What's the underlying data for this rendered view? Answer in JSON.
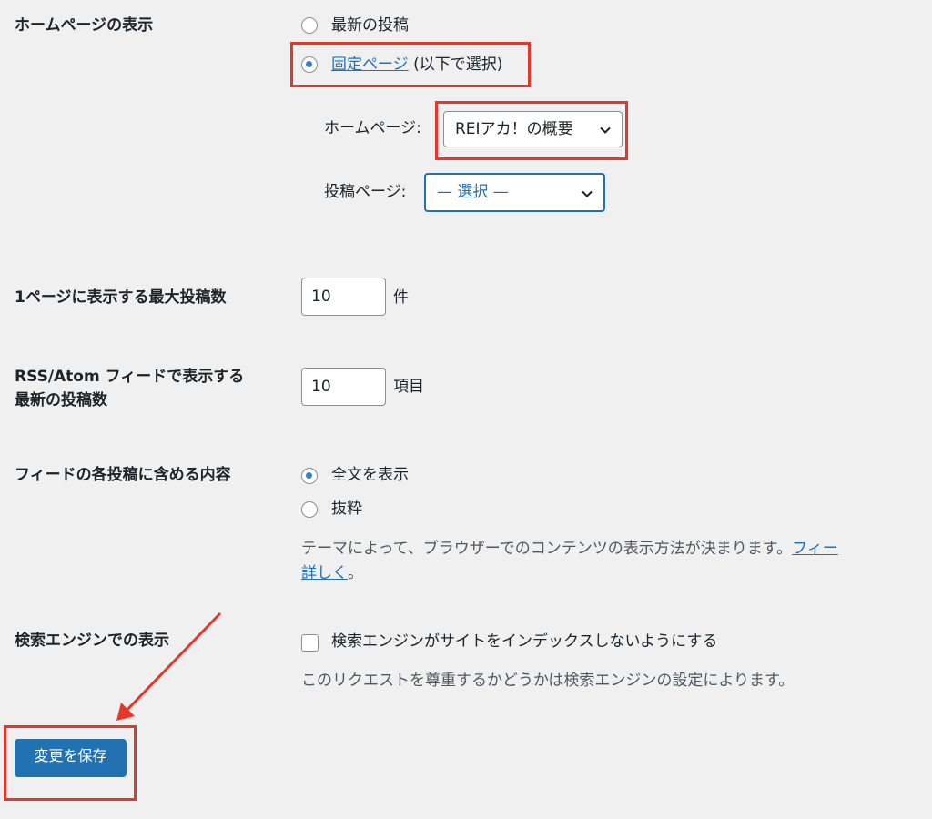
{
  "homepage_display": {
    "label": "ホームページの表示",
    "option_latest": "最新の投稿",
    "option_static_link": "固定ページ",
    "option_static_suffix": " (以下で選択)",
    "homepage_select_label": "ホームページ:",
    "homepage_select_value": "REIアカ！の概要",
    "posts_page_label": "投稿ページ:",
    "posts_page_value": "— 選択 —"
  },
  "posts_per_page": {
    "label": "1ページに表示する最大投稿数",
    "value": "10",
    "unit": "件"
  },
  "rss": {
    "label_line1": "RSS/Atom フィードで表示する",
    "label_line2": "最新の投稿数",
    "value": "10",
    "unit": "項目"
  },
  "feed_content": {
    "label": "フィードの各投稿に含める内容",
    "option_full": "全文を表示",
    "option_excerpt": "抜粋",
    "description": "テーマによって、ブラウザーでのコンテンツの表示方法が決まります。",
    "description_link": "フィー",
    "more_link": "詳しく",
    "more_suffix": "。"
  },
  "search_engine": {
    "label": "検索エンジンでの表示",
    "checkbox_label": "検索エンジンがサイトをインデックスしないようにする",
    "description": "このリクエストを尊重するかどうかは検索エンジンの設定によります。"
  },
  "save_button": "変更を保存",
  "colors": {
    "accent": "#2271b1",
    "annotation": "#e8362b",
    "background": "#f0f0f1"
  }
}
